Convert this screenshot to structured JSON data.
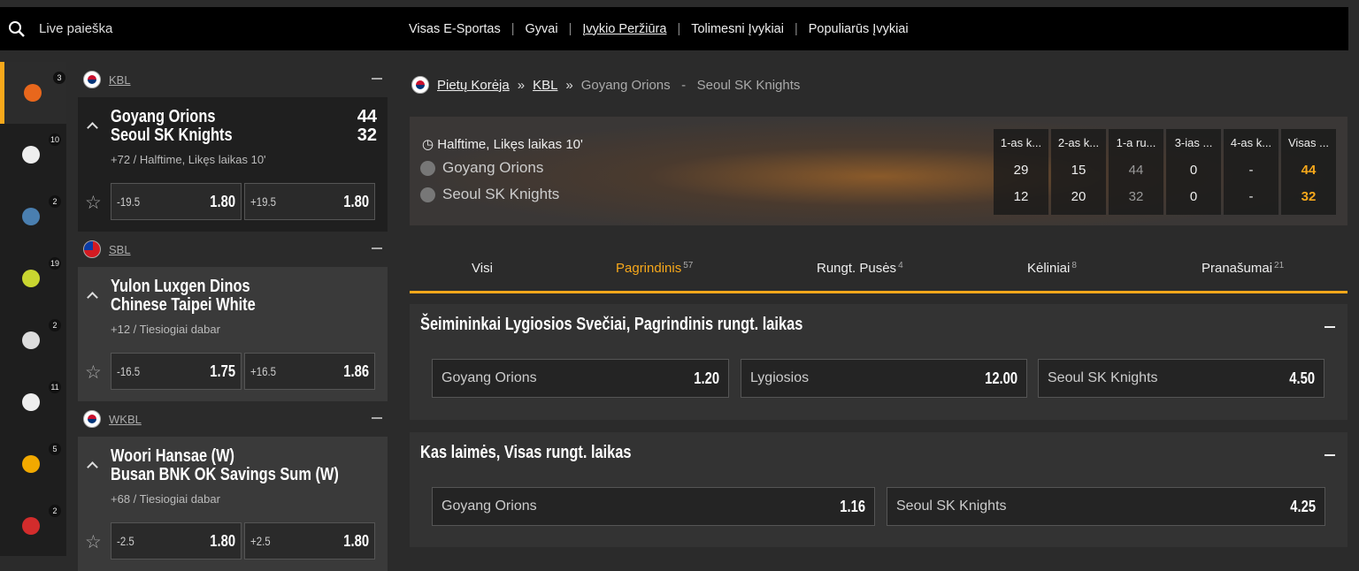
{
  "search": {
    "placeholder": "Live paieška"
  },
  "topnav": [
    "Visas E-Sportas",
    "Gyvai",
    "Įvykio Peržiūra",
    "Tolimesni Įvykiai",
    "Populiarūs Įvykiai"
  ],
  "sports": [
    {
      "icon": "basketball-icon",
      "count": "3",
      "color": "#e8671c"
    },
    {
      "icon": "soccer-ball-icon",
      "count": "10",
      "color": "#eeeeee"
    },
    {
      "icon": "hockey-icon",
      "count": "2",
      "color": "#4a7fb0"
    },
    {
      "icon": "tennis-ball-icon",
      "count": "19",
      "color": "#c9d630"
    },
    {
      "icon": "volleyball-icon",
      "count": "2",
      "color": "#dddddd"
    },
    {
      "icon": "baseball-icon",
      "count": "11",
      "color": "#eeeeee"
    },
    {
      "icon": "counter-strike-icon",
      "count": "5",
      "color": "#f2a900"
    },
    {
      "icon": "dota-icon",
      "count": "2",
      "color": "#d32c2c"
    }
  ],
  "events": [
    {
      "league": "KBL",
      "team1": "Goyang Orions",
      "team2": "Seoul SK Knights",
      "score1": "44",
      "score2": "32",
      "meta": "+72 / Halftime, Likęs laikas 10'",
      "h1": "-19.5",
      "o1": "1.80",
      "h2": "+19.5",
      "o2": "1.80"
    },
    {
      "league": "SBL",
      "team1": "Yulon Luxgen Dinos",
      "team2": "Chinese Taipei White",
      "score1": "",
      "score2": "",
      "meta": "+12 / Tiesiogiai dabar",
      "h1": "-16.5",
      "o1": "1.75",
      "h2": "+16.5",
      "o2": "1.86"
    },
    {
      "league": "WKBL",
      "team1": "Woori Hansae (W)",
      "team2": "Busan BNK OK Savings Sum (W)",
      "score1": "",
      "score2": "",
      "meta": "+68 / Tiesiogiai dabar",
      "h1": "-2.5",
      "o1": "1.80",
      "h2": "+2.5",
      "o2": "1.80"
    }
  ],
  "breadcrumb": {
    "country": "Pietų Korėja",
    "league": "KBL",
    "match": "Goyang Orions   -   Seoul SK Knights"
  },
  "scoreboard": {
    "time": "Halftime, Likęs laikas 10'",
    "team1": "Goyang Orions",
    "team2": "Seoul SK Knights",
    "columns": [
      {
        "head": "1-as k...",
        "t1": "29",
        "t2": "12"
      },
      {
        "head": "2-as k...",
        "t1": "15",
        "t2": "20"
      },
      {
        "head": "1-a ru...",
        "t1": "44",
        "t2": "32"
      },
      {
        "head": "3-ias ...",
        "t1": "0",
        "t2": "0"
      },
      {
        "head": "4-as k...",
        "t1": "-",
        "t2": "-"
      },
      {
        "head": "Visas ...",
        "t1": "44",
        "t2": "32"
      }
    ]
  },
  "tabs": [
    {
      "label": "Visi",
      "count": ""
    },
    {
      "label": "Pagrindinis",
      "count": "57"
    },
    {
      "label": "Rungt. Pusės",
      "count": "4"
    },
    {
      "label": "Kėliniai",
      "count": "8"
    },
    {
      "label": "Pranašumai",
      "count": "21"
    }
  ],
  "markets": [
    {
      "title": "Šeimininkai Lygiosios Svečiai, Pagrindinis rungt. laikas",
      "selections": [
        {
          "name": "Goyang Orions",
          "odd": "1.20"
        },
        {
          "name": "Lygiosios",
          "odd": "12.00"
        },
        {
          "name": "Seoul SK Knights",
          "odd": "4.50"
        }
      ]
    },
    {
      "title": "Kas laimės, Visas rungt. laikas",
      "selections": [
        {
          "name": "Goyang Orions",
          "odd": "1.16"
        },
        {
          "name": "Seoul SK Knights",
          "odd": "4.25"
        }
      ]
    }
  ],
  "accent": "#f7a81b"
}
